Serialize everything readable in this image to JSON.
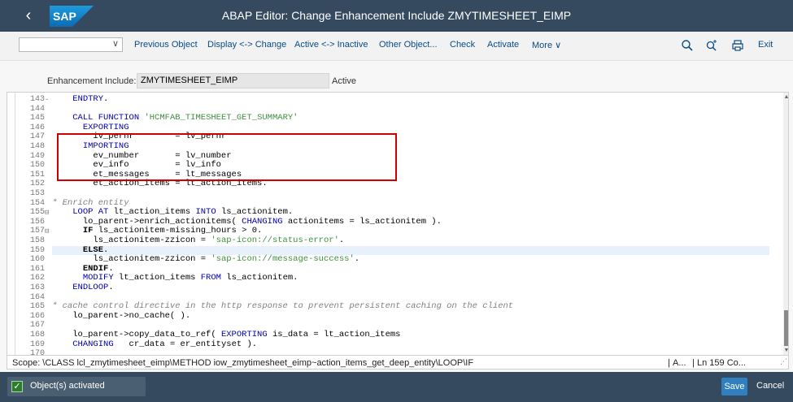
{
  "header": {
    "title": "ABAP Editor: Change Enhancement Include ZMYTIMESHEET_EIMP",
    "logo_text": "SAP"
  },
  "toolbar": {
    "dropdown_value": "",
    "buttons": [
      {
        "label": "Previous Object"
      },
      {
        "label": "Display <-> Change"
      },
      {
        "label": "Active <-> Inactive"
      },
      {
        "label": "Other Object..."
      },
      {
        "label": "Check"
      },
      {
        "label": "Activate"
      },
      {
        "label": "More"
      }
    ],
    "icons": [
      "search-icon",
      "find-next-icon",
      "print-icon"
    ],
    "exit_label": "Exit"
  },
  "enhancement": {
    "label": "Enhancement Include:",
    "value": "ZMYTIMESHEET_EIMP",
    "status": "Active"
  },
  "editor": {
    "current_line": "159",
    "lines": [
      {
        "num": "143",
        "fold": "-",
        "code": "    ENDTRY."
      },
      {
        "num": "144",
        "fold": "",
        "code": ""
      },
      {
        "num": "145",
        "fold": "",
        "code": "    CALL FUNCTION 'HCMFAB_TIMESHEET_GET_SUMMARY'"
      },
      {
        "num": "146",
        "fold": "",
        "code": "      EXPORTING"
      },
      {
        "num": "147",
        "fold": "",
        "code": "        iv_pernr        = lv_pernr"
      },
      {
        "num": "148",
        "fold": "",
        "code": "      IMPORTING"
      },
      {
        "num": "149",
        "fold": "",
        "code": "        ev_number       = lv_number"
      },
      {
        "num": "150",
        "fold": "",
        "code": "        ev_info         = lv_info"
      },
      {
        "num": "151",
        "fold": "",
        "code": "        et_messages     = lt_messages"
      },
      {
        "num": "152",
        "fold": "",
        "code": "        et_action_items = lt_action_items."
      },
      {
        "num": "153",
        "fold": "",
        "code": ""
      },
      {
        "num": "154",
        "fold": "",
        "code": "* Enrich entity"
      },
      {
        "num": "155",
        "fold": "⊟",
        "code": "    LOOP AT lt_action_items INTO ls_actionitem."
      },
      {
        "num": "156",
        "fold": "",
        "code": "      lo_parent->enrich_actionitems( CHANGING actionitems = ls_actionitem )."
      },
      {
        "num": "157",
        "fold": "⊟",
        "code": "      IF ls_actionitem-missing_hours > 0."
      },
      {
        "num": "158",
        "fold": "",
        "code": "        ls_actionitem-zzicon = 'sap-icon://status-error'."
      },
      {
        "num": "159",
        "fold": "",
        "code": "      ELSE."
      },
      {
        "num": "160",
        "fold": "",
        "code": "        ls_actionitem-zzicon = 'sap-icon://message-success'."
      },
      {
        "num": "161",
        "fold": "",
        "code": "      ENDIF."
      },
      {
        "num": "162",
        "fold": "",
        "code": "      MODIFY lt_action_items FROM ls_actionitem."
      },
      {
        "num": "163",
        "fold": "",
        "code": "    ENDLOOP."
      },
      {
        "num": "164",
        "fold": "",
        "code": ""
      },
      {
        "num": "165",
        "fold": "",
        "code": "* cache control directive in the http response to prevent persistent caching on the client"
      },
      {
        "num": "166",
        "fold": "",
        "code": "    lo_parent->no_cache( )."
      },
      {
        "num": "167",
        "fold": "",
        "code": ""
      },
      {
        "num": "168",
        "fold": "",
        "code": "    lo_parent->copy_data_to_ref( EXPORTING is_data = lt_action_items"
      },
      {
        "num": "169",
        "fold": "",
        "code": "    CHANGING   cr_data = er_entityset )."
      },
      {
        "num": "170",
        "fold": "",
        "code": ""
      }
    ]
  },
  "statusbar": {
    "scope": "Scope: \\CLASS lcl_zmytimesheet_eimp\\METHOD iow_zmytimesheet_eimp~action_items_get_deep_entity\\LOOP\\IF",
    "sep": "|",
    "mode": "A...",
    "position": "Ln 159 Co..."
  },
  "footer": {
    "message": "Object(s) activated",
    "save_label": "Save",
    "cancel_label": "Cancel"
  },
  "colors": {
    "shell": "#354a5f",
    "highlight_box": "#d00000",
    "save_button": "#2f7fc1"
  }
}
